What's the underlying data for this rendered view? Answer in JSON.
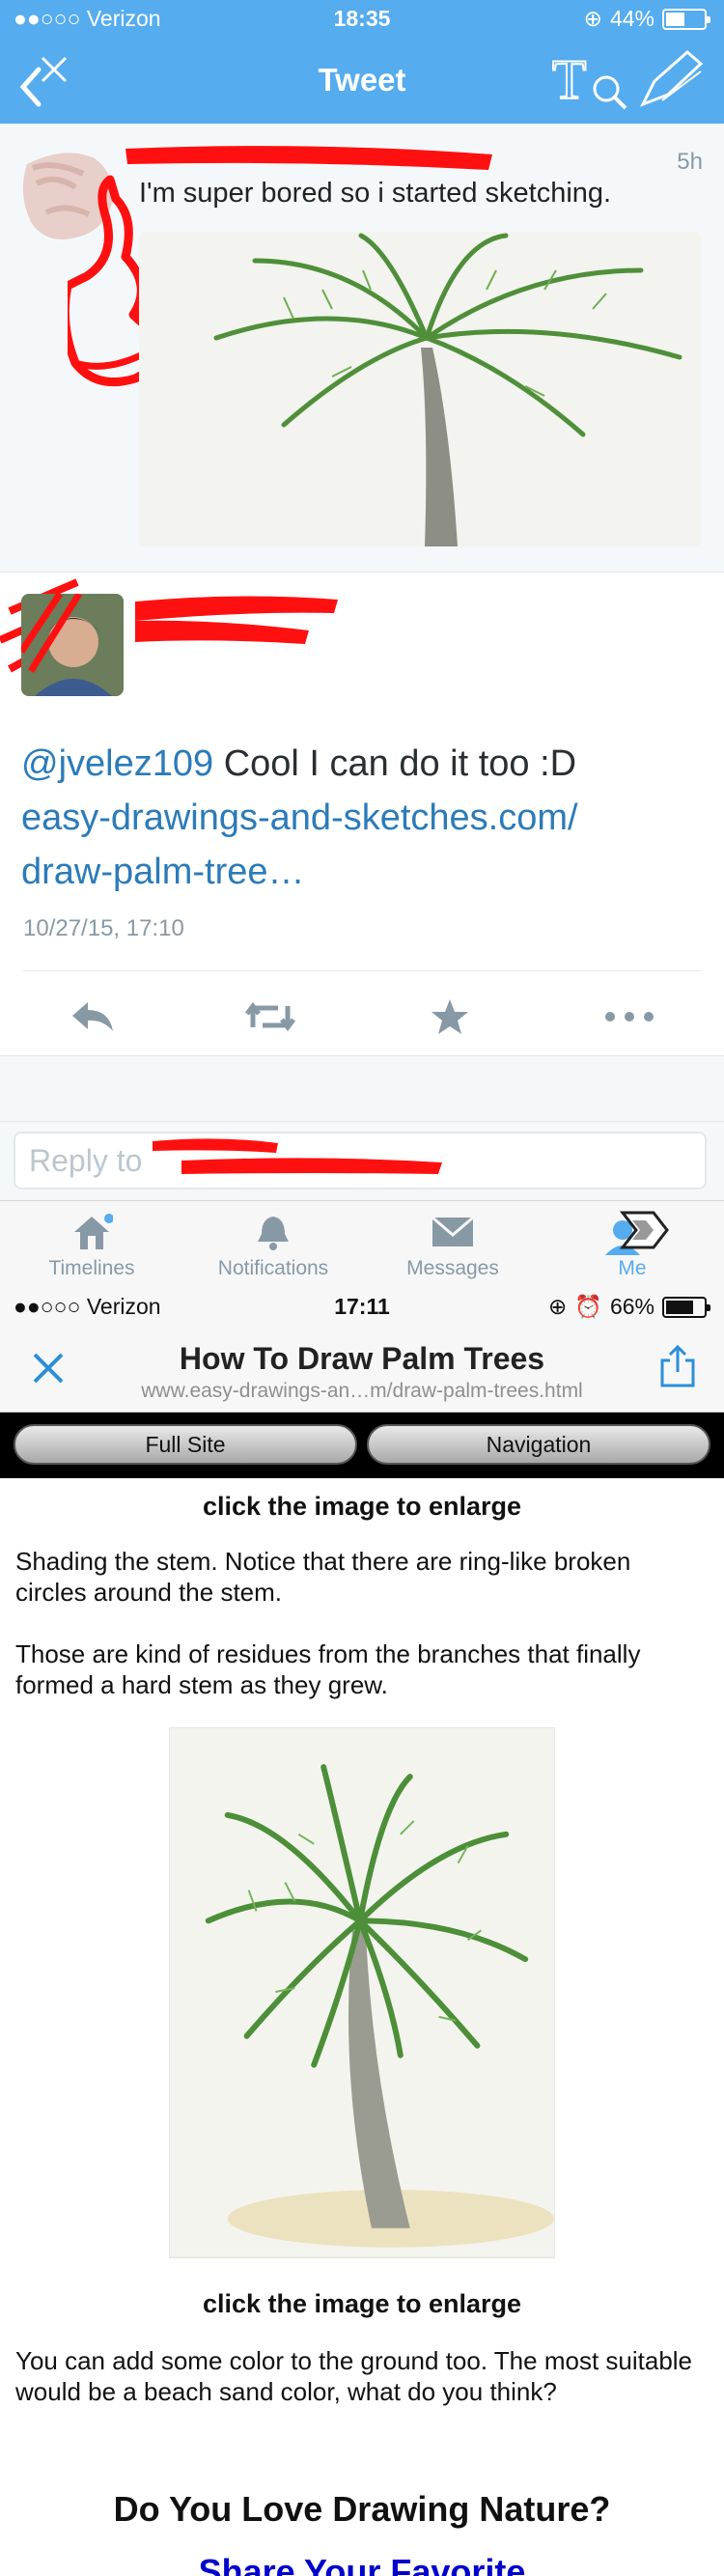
{
  "twitter": {
    "status_bar": {
      "carrier": "●●○○○ Verizon",
      "time": "18:35",
      "battery": "44%",
      "battery_level": 0.44
    },
    "nav": {
      "title": "Tweet"
    },
    "top_tweet": {
      "time": "5h",
      "text": "I'm super bored so i started sketching."
    },
    "detail": {
      "mention": "@jvelez109",
      "body": " Cool I can do it too :D",
      "link_line1": "easy-drawings-and-sketches.com/",
      "link_line2": "draw-palm-tree…",
      "date": "10/27/15, 17:10"
    },
    "reply": {
      "placeholder": "Reply to "
    },
    "tabs": [
      {
        "label": "Timelines",
        "icon": "home-icon"
      },
      {
        "label": "Notifications",
        "icon": "bell-icon"
      },
      {
        "label": "Messages",
        "icon": "envelope-icon"
      },
      {
        "label": "Me",
        "icon": "person-icon"
      }
    ]
  },
  "browser": {
    "status_bar": {
      "carrier": "●●○○○ Verizon",
      "time": "17:11",
      "battery": "66%",
      "battery_level": 0.66
    },
    "title": "How To Draw Palm Trees",
    "url": "www.easy-drawings-an…m/draw-palm-trees.html",
    "site_nav": {
      "full_site": "Full Site",
      "navigation": "Navigation"
    },
    "content": {
      "hint1": "click the image to enlarge",
      "para1": "Shading the stem. Notice that there are ring-like broken circles around the stem.",
      "para2": "Those are kind of residues from the branches that finally formed a hard stem as they grew.",
      "hint2": "click the image to enlarge",
      "para3": "You can add some color to the ground too. The most suitable would be a beach sand color, what do you think?",
      "heading": "Do You Love Drawing Nature?",
      "blue_heading": "Share Your Favorite"
    }
  },
  "colors": {
    "twitter_blue": "#55acee",
    "link_blue": "#2b7bb9",
    "redaction_red": "#ff1010"
  }
}
